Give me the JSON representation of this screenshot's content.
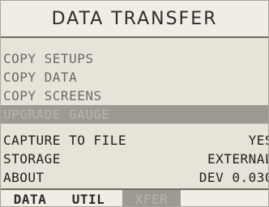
{
  "header": {
    "title": "DATA TRANSFER"
  },
  "menu": {
    "items": [
      {
        "label": "COPY SETUPS"
      },
      {
        "label": "COPY DATA"
      },
      {
        "label": "COPY SCREENS"
      },
      {
        "label": "UPGRADE GAUGE"
      }
    ]
  },
  "settings": {
    "capture": {
      "label": "CAPTURE TO FILE",
      "value": "YES"
    },
    "storage": {
      "label": "STORAGE",
      "value": "EXTERNAL"
    },
    "about": {
      "label": "ABOUT",
      "value": "DEV 0.030"
    }
  },
  "tabs": [
    {
      "label": "DATA"
    },
    {
      "label": "UTIL"
    },
    {
      "label": "XFER"
    }
  ]
}
